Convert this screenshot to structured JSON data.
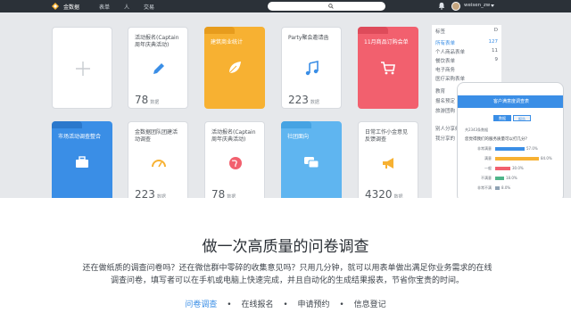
{
  "topbar": {
    "logo_text": "金数据",
    "nav": [
      "表单",
      "人",
      "交易"
    ],
    "user": "weisen_zw"
  },
  "cards": [
    {
      "title": "",
      "count": "",
      "unit": ""
    },
    {
      "title": "活动报名(Captain周年庆典活动)",
      "count": "78",
      "unit": "数据"
    },
    {
      "title": "建筑商业统计",
      "count": "",
      "unit": "",
      "color": "#f7b132"
    },
    {
      "title": "Party聚会邀请函",
      "count": "223",
      "unit": "数据"
    },
    {
      "title": "11月商品订购会单",
      "count": "",
      "unit": "",
      "color": "#f2606e"
    },
    {
      "title": "市场活动调查整合",
      "count": "",
      "unit": "",
      "color": "#3a8ee6"
    },
    {
      "title": "金数据团队团建活动调查",
      "count": "223",
      "unit": "数据"
    },
    {
      "title": "活动报名(Captain周年庆典活动)",
      "count": "78",
      "unit": "数据"
    },
    {
      "title": "社团面向",
      "count": "",
      "unit": "",
      "color": "#5fb5f0"
    },
    {
      "title": "日常工作小金意见反馈调查",
      "count": "4320",
      "unit": "数据"
    }
  ],
  "sidebar": {
    "header": "标签",
    "header_count": "D",
    "rows": [
      {
        "label": "所有表单",
        "n": "127",
        "accent": true
      },
      {
        "label": "个人商品表单",
        "n": "11"
      },
      {
        "label": "餐饮表单",
        "n": "9"
      },
      {
        "label": "电子商务",
        "n": ""
      },
      {
        "label": "医疗采购表单",
        "n": ""
      },
      {
        "label": "教育",
        "n": ""
      },
      {
        "label": "报名预定",
        "n": ""
      },
      {
        "label": "旅游团购",
        "n": ""
      },
      {
        "label": "别人分享给",
        "n": ""
      },
      {
        "label": "我分享的",
        "n": ""
      }
    ]
  },
  "phone": {
    "header": "客户满意度调查表",
    "tabs": [
      "数据",
      "报告"
    ],
    "meta": "共2343条数据",
    "question": "您觉得我们的服务质量可以打几分?",
    "bars": [
      {
        "label": "非常满意",
        "value": 57.0,
        "color": "#3a8ee6"
      },
      {
        "label": "满意",
        "value": 84.0,
        "color": "#f7b132"
      },
      {
        "label": "一般",
        "value": 30.0,
        "color": "#f2606e"
      },
      {
        "label": "不满意",
        "value": 18.0,
        "color": "#4fb58a"
      },
      {
        "label": "非常不满",
        "value": 8.0,
        "color": "#8fa2b3"
      }
    ],
    "bar_labels": [
      "57.0%",
      "84.0%",
      "30.0%",
      "18.0%",
      "8.0%"
    ]
  },
  "hero": {
    "title": "做一次高质量的问卷调查",
    "desc_line1": "还在做纸质的调查问卷吗？还在微信群中零碎的收集意见吗？只用几分钟，就可以用表单做出满足你业务需求的在线",
    "desc_line2": "调查问卷，填写者可以在手机或电脑上快速完成，并且自动化的生成结果报表，节省你宝贵的时间。",
    "links": [
      "问卷调查",
      "在线报名",
      "申请预约",
      "信息登记"
    ]
  },
  "colors": {
    "accent": "#3a8ee6",
    "topbar": "#2b3138"
  }
}
